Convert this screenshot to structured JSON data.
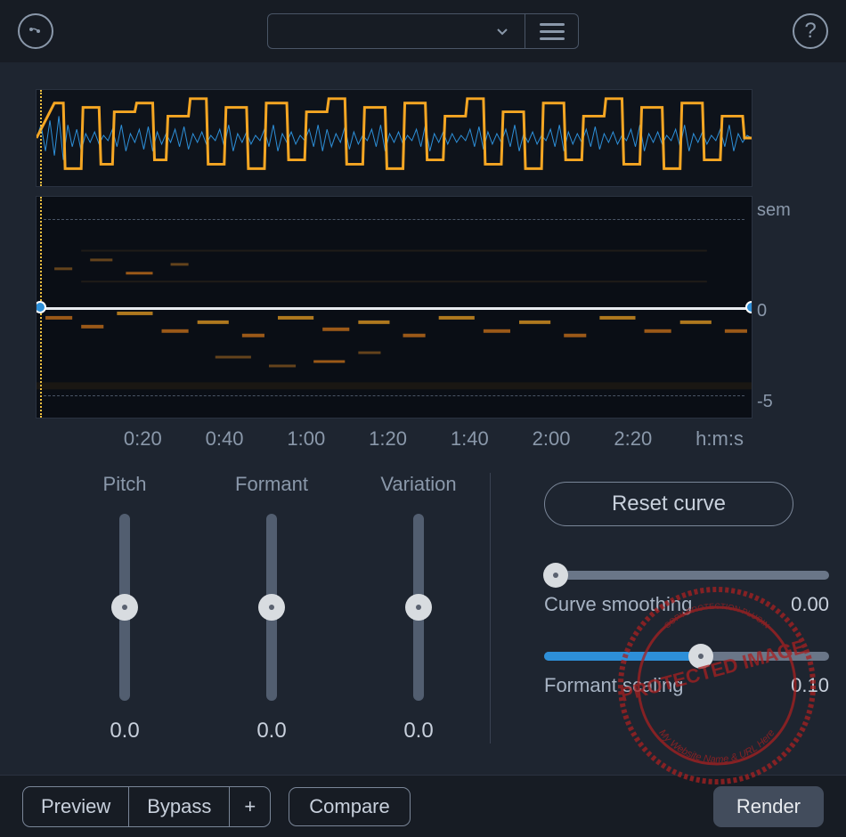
{
  "header": {
    "preset_value": "",
    "help_glyph": "?"
  },
  "axes": {
    "y_unit": "sem",
    "y_zero": "0",
    "y_low": "-5",
    "x_unit": "h:m:s",
    "x_ticks": [
      "0:20",
      "0:40",
      "1:00",
      "1:20",
      "1:40",
      "2:00",
      "2:20"
    ]
  },
  "sliders": {
    "pitch": {
      "label": "Pitch",
      "value": "0.0",
      "pos_percent": 50
    },
    "formant": {
      "label": "Formant",
      "value": "0.0",
      "pos_percent": 50
    },
    "variation": {
      "label": "Variation",
      "value": "0.0",
      "pos_percent": 50
    }
  },
  "right": {
    "reset_label": "Reset curve",
    "smoothing": {
      "label": "Curve smoothing",
      "value": "0.00",
      "pos_percent": 4
    },
    "scaling": {
      "label": "Formant scaling",
      "value": "0.10",
      "pos_percent": 55
    }
  },
  "footer": {
    "preview": "Preview",
    "bypass": "Bypass",
    "plus": "+",
    "compare": "Compare",
    "render": "Render"
  },
  "watermark": {
    "line1": "PROTECTED IMAGE",
    "line2": "My Website Name & URL Here",
    "line3": "COPY PROTECTION PLUGIN"
  }
}
